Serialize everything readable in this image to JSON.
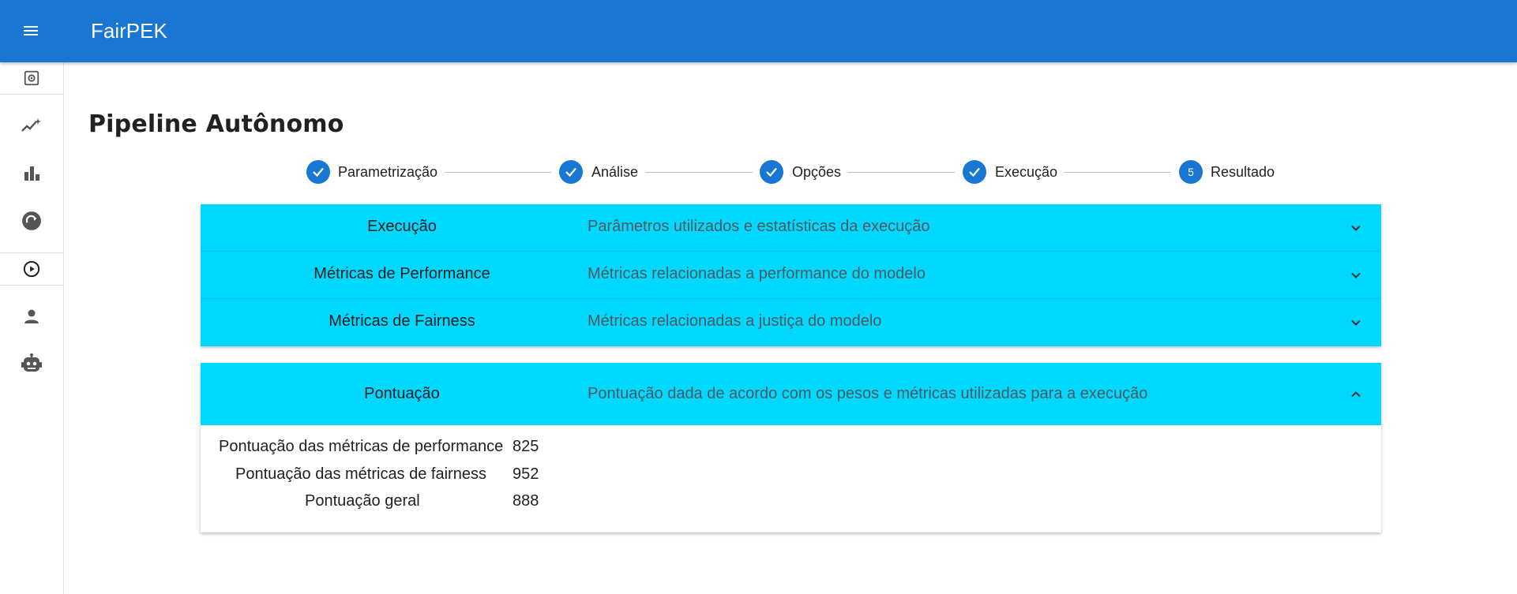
{
  "app": {
    "title": "FairPEK"
  },
  "icons": {
    "menu": "menu-icon",
    "sidebar": [
      "settings-icon",
      "trending-icon",
      "bar-chart-icon",
      "refresh-circle-icon",
      "play-circle-icon",
      "person-icon",
      "robot-icon"
    ]
  },
  "page": {
    "title": "Pipeline Autônomo"
  },
  "stepper": {
    "steps": [
      {
        "label": "Parametrização",
        "state": "done"
      },
      {
        "label": "Análise",
        "state": "done"
      },
      {
        "label": "Opções",
        "state": "done"
      },
      {
        "label": "Execução",
        "state": "done"
      },
      {
        "label": "Resultado",
        "state": "active",
        "number": "5"
      }
    ]
  },
  "panels": [
    {
      "title": "Execução",
      "description": "Parâmetros utilizados e estatísticas da execução",
      "expanded": false
    },
    {
      "title": "Métricas de Performance",
      "description": "Métricas relacionadas a performance do modelo",
      "expanded": false
    },
    {
      "title": "Métricas de Fairness",
      "description": "Métricas relacionadas a justiça do modelo",
      "expanded": false
    }
  ],
  "score": {
    "title": "Pontuação",
    "description": "Pontuação dada de acordo com os pesos e métricas utilizadas para a execução",
    "expanded": true,
    "rows": [
      {
        "label": "Pontuação das métricas de performance",
        "value": "825"
      },
      {
        "label": "Pontuação das métricas de fairness",
        "value": "952"
      },
      {
        "label": "Pontuação geral",
        "value": "888"
      }
    ]
  },
  "colors": {
    "appbar": "#1976d2",
    "panel": "#00d8ff",
    "step": "#1976d2"
  }
}
